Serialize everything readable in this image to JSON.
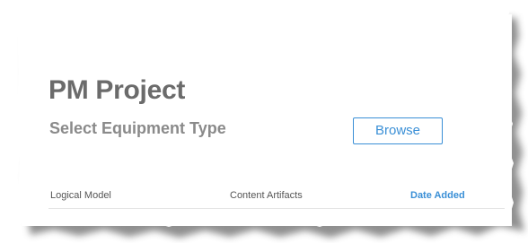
{
  "page": {
    "title": "PM Project",
    "subtitle": "Select Equipment Type",
    "browse_label": "Browse"
  },
  "table": {
    "columns": [
      "Logical Model",
      "Content Artifacts",
      "Date Added"
    ]
  },
  "colors": {
    "accent": "#3a8fd6",
    "title_text": "#6b6b6b",
    "subtitle_text": "#8a8a8a"
  }
}
